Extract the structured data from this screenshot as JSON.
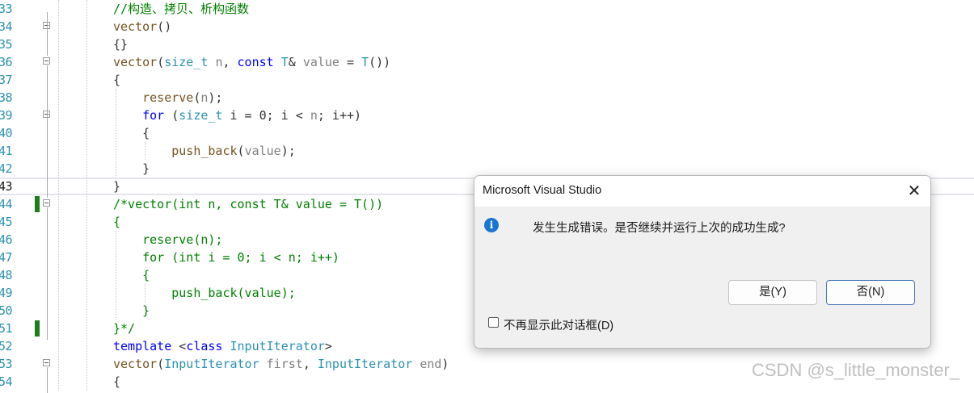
{
  "editor": {
    "lines": [
      {
        "n": "33",
        "code": [
          {
            "c": "cm",
            "t": "//构造、拷贝、析构函数"
          }
        ]
      },
      {
        "n": "34",
        "code": [
          {
            "c": "fn",
            "t": "vector"
          },
          {
            "c": "op",
            "t": "()"
          }
        ]
      },
      {
        "n": "35",
        "code": [
          {
            "c": "op",
            "t": "{}"
          }
        ]
      },
      {
        "n": "36",
        "code": [
          {
            "c": "fn",
            "t": "vector"
          },
          {
            "c": "op",
            "t": "("
          },
          {
            "c": "ty",
            "t": "size_t"
          },
          {
            "c": "op",
            "t": " "
          },
          {
            "c": "pm",
            "t": "n"
          },
          {
            "c": "op",
            "t": ", "
          },
          {
            "c": "kw",
            "t": "const"
          },
          {
            "c": "op",
            "t": " "
          },
          {
            "c": "ty",
            "t": "T"
          },
          {
            "c": "op",
            "t": "& "
          },
          {
            "c": "pm",
            "t": "value"
          },
          {
            "c": "op",
            "t": " = "
          },
          {
            "c": "ty",
            "t": "T"
          },
          {
            "c": "op",
            "t": "())"
          }
        ]
      },
      {
        "n": "37",
        "code": [
          {
            "c": "op",
            "t": "{"
          }
        ]
      },
      {
        "n": "38",
        "code": [
          {
            "c": "op",
            "t": "    "
          },
          {
            "c": "fn",
            "t": "reserve"
          },
          {
            "c": "op",
            "t": "("
          },
          {
            "c": "pm",
            "t": "n"
          },
          {
            "c": "op",
            "t": ");"
          }
        ]
      },
      {
        "n": "39",
        "code": [
          {
            "c": "op",
            "t": "    "
          },
          {
            "c": "kw",
            "t": "for"
          },
          {
            "c": "op",
            "t": " ("
          },
          {
            "c": "ty",
            "t": "size_t"
          },
          {
            "c": "op",
            "t": " i = 0; i < "
          },
          {
            "c": "pm",
            "t": "n"
          },
          {
            "c": "op",
            "t": "; i++)"
          }
        ]
      },
      {
        "n": "40",
        "code": [
          {
            "c": "op",
            "t": "    {"
          }
        ]
      },
      {
        "n": "41",
        "code": [
          {
            "c": "op",
            "t": "        "
          },
          {
            "c": "fn",
            "t": "push_back"
          },
          {
            "c": "op",
            "t": "("
          },
          {
            "c": "pm",
            "t": "value"
          },
          {
            "c": "op",
            "t": ");"
          }
        ]
      },
      {
        "n": "42",
        "code": [
          {
            "c": "op",
            "t": "    }"
          }
        ]
      },
      {
        "n": "43",
        "code": [
          {
            "c": "op",
            "t": "}"
          }
        ]
      },
      {
        "n": "44",
        "code": [
          {
            "c": "cm",
            "t": "/*vector(int n, const T& value = T())"
          }
        ]
      },
      {
        "n": "45",
        "code": [
          {
            "c": "cm",
            "t": "{"
          }
        ]
      },
      {
        "n": "46",
        "code": [
          {
            "c": "cm",
            "t": "    reserve(n);"
          }
        ]
      },
      {
        "n": "47",
        "code": [
          {
            "c": "cm",
            "t": "    for (int i = 0; i < n; i++)"
          }
        ]
      },
      {
        "n": "48",
        "code": [
          {
            "c": "cm",
            "t": "    {"
          }
        ]
      },
      {
        "n": "49",
        "code": [
          {
            "c": "cm",
            "t": "        push_back(value);"
          }
        ]
      },
      {
        "n": "50",
        "code": [
          {
            "c": "cm",
            "t": "    }"
          }
        ]
      },
      {
        "n": "51",
        "code": [
          {
            "c": "cm",
            "t": "}*/"
          }
        ]
      },
      {
        "n": "52",
        "code": [
          {
            "c": "kw",
            "t": "template"
          },
          {
            "c": "op",
            "t": " <"
          },
          {
            "c": "kw",
            "t": "class"
          },
          {
            "c": "op",
            "t": " "
          },
          {
            "c": "ty",
            "t": "InputIterator"
          },
          {
            "c": "op",
            "t": ">"
          }
        ]
      },
      {
        "n": "53",
        "code": [
          {
            "c": "fn",
            "t": "vector"
          },
          {
            "c": "op",
            "t": "("
          },
          {
            "c": "ty",
            "t": "InputIterator"
          },
          {
            "c": "op",
            "t": " "
          },
          {
            "c": "pm",
            "t": "first"
          },
          {
            "c": "op",
            "t": ", "
          },
          {
            "c": "ty",
            "t": "InputIterator"
          },
          {
            "c": "op",
            "t": " "
          },
          {
            "c": "pm",
            "t": "end"
          },
          {
            "c": "op",
            "t": ")"
          }
        ]
      },
      {
        "n": "54",
        "code": [
          {
            "c": "op",
            "t": "{"
          }
        ]
      }
    ]
  },
  "dialog": {
    "title": "Microsoft Visual Studio",
    "close_label": "✕",
    "info_icon": "i",
    "message": "发生生成错误。是否继续并运行上次的成功生成?",
    "yes_label": "是(Y)",
    "no_label": "否(N)",
    "checkbox_label": "不再显示此对话框(D)"
  },
  "watermark": "CSDN @s_little_monster_",
  "colors": {
    "keyword": "#0000ff",
    "type": "#2b91af",
    "comment": "#008000",
    "change_bar": "#1e7b1e",
    "info_icon": "#1976d2"
  }
}
